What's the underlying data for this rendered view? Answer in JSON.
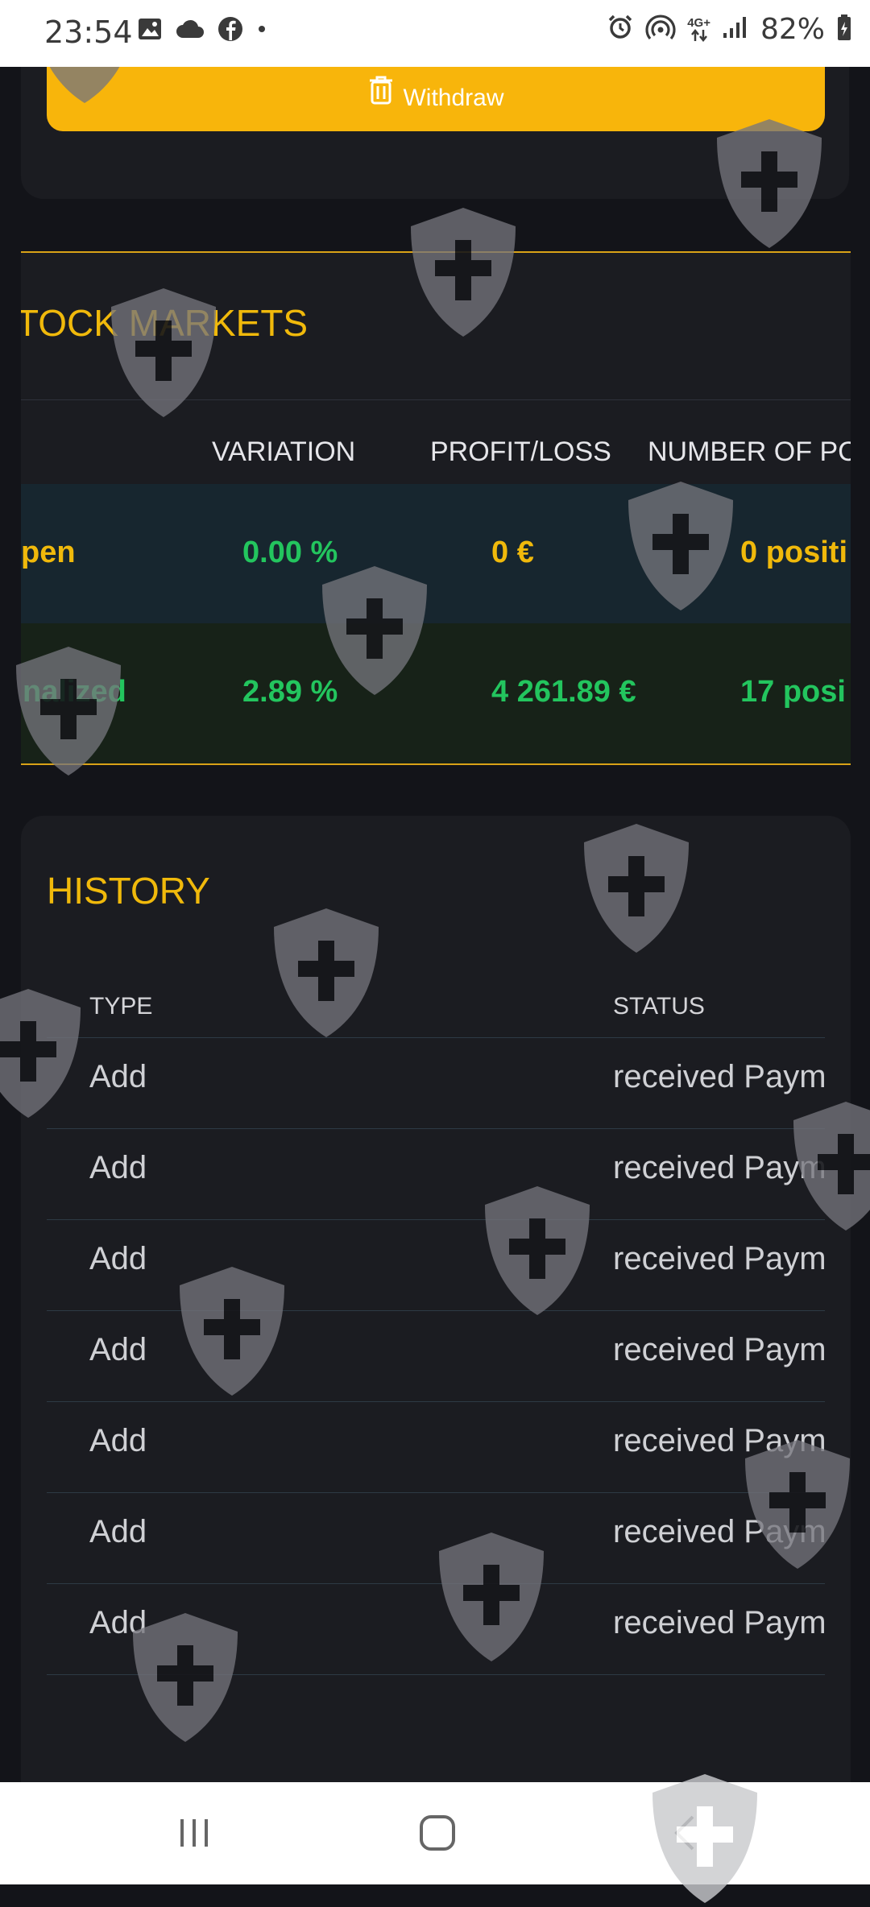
{
  "status_bar": {
    "time": "23:54",
    "left_icons": [
      "gallery-icon",
      "cloud-icon",
      "facebook-icon",
      "dot-icon"
    ],
    "right_icons": [
      "alarm-icon",
      "hotspot-icon",
      "4g-icon",
      "signal-icon",
      "battery-icon"
    ],
    "network": "4G+",
    "battery": "82%"
  },
  "wallet": {
    "withdraw_label": "Withdraw",
    "accent": "#f8b50b"
  },
  "markets": {
    "title": "TOCK MARKETS",
    "columns": [
      "VARIATION",
      "PROFIT/LOSS",
      "NUMBER OF PC"
    ],
    "rows": [
      {
        "label": "pen",
        "variation": "0.00 %",
        "profit": "0 €",
        "positions": "0 positi"
      },
      {
        "label": "nalized",
        "variation": "2.89 %",
        "profit": "4 261.89 €",
        "positions": "17 posi"
      }
    ],
    "colors": {
      "green": "#23c55e",
      "amber": "#f0b90b"
    }
  },
  "history": {
    "title": "HISTORY",
    "columns": {
      "type": "TYPE",
      "status": "STATUS"
    },
    "rows": [
      {
        "type": "Add",
        "status": "received Payment"
      },
      {
        "type": "Add",
        "status": "received Payment"
      },
      {
        "type": "Add",
        "status": "received Payment"
      },
      {
        "type": "Add",
        "status": "received Payment"
      },
      {
        "type": "Add",
        "status": "received Payment"
      },
      {
        "type": "Add",
        "status": "received Payment"
      },
      {
        "type": "Add",
        "status": "received Payment"
      }
    ]
  },
  "nav_bar": {
    "buttons": [
      "recent-apps-icon",
      "home-icon",
      "back-icon"
    ]
  }
}
